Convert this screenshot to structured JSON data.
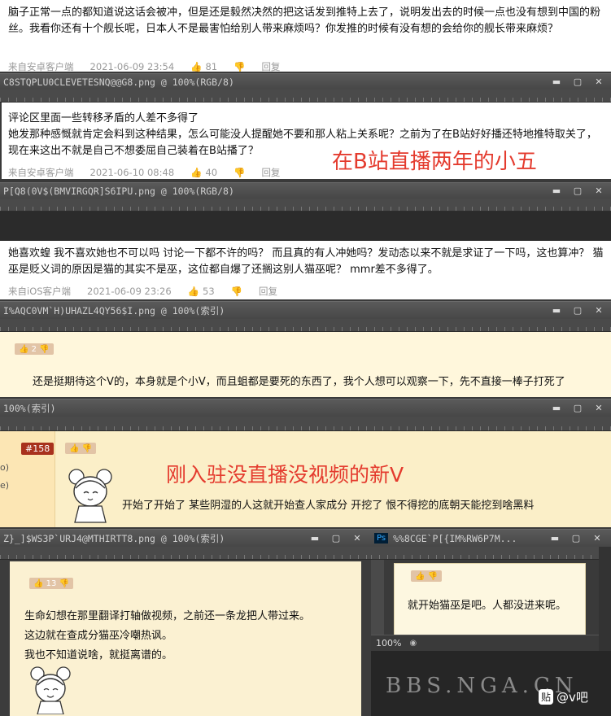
{
  "comments": [
    {
      "text": "脑子正常一点的都知道说这话会被冲，但是还是毅然决然的把这话发到推特上去了，说明发出去的时候一点也没有想到中国的粉丝。我看你还有十个舰长呢，日本人不是最害怕给别人带来麻烦吗？你发推的时候有没有想的会给你的舰长带来麻烦？",
      "source": "来自安卓客户端",
      "date": "2021-06-09 23:54",
      "likes": "81",
      "reply": "回复"
    },
    {
      "text": "评论区里面一些转移矛盾的人差不多得了\n她发那种感慨就肯定会料到这种结果，怎么可能没人提醒她不要和那人粘上关系呢？之前为了在B站好好播还特地推特取关了，现在来这出不就是自己不想委屈自己装着在B站播了？",
      "source": "来自安卓客户端",
      "date": "2021-06-10 08:48",
      "likes": "40",
      "reply": "回复",
      "overlay": "在B站直播两年的小五"
    },
    {
      "text": "她喜欢蝗 我不喜欢她也不可以吗 讨论一下都不许的吗？ 而且真的有人冲她吗？发动态以来不就是求证了一下吗，这也算冲？ 猫巫是贬义词的原因是猫的其实不是巫，这位都自爆了还搁这别人猫巫呢？ mmr差不多得了。",
      "source": "来自iOS客户端",
      "date": "2021-06-09 23:26",
      "likes": "53",
      "reply": "回复"
    }
  ],
  "ps_windows": [
    {
      "title": "C8STQPLU0CLEVETESNQ@@G8.png @ 100%(RGB/8)"
    },
    {
      "title": "P[Q8(0V$(BMVIRGQR]S6IPU.png @ 100%(RGB/8)"
    },
    {
      "title": "I%AQC0VM`H)UHAZL4QY56$I.png @ 100%(索引)"
    },
    {
      "title": "100%(索引)"
    },
    {
      "title": "Z}_]$WS3P`URJ4@MTHIRTT8.png @ 100%(索引)"
    },
    {
      "title": "%%8CGE`P[{IM%RW6P7M..."
    }
  ],
  "window_buttons": {
    "min": "▬",
    "max": "▢",
    "close": "✕"
  },
  "nga_posts": [
    {
      "likes": "2",
      "text": "还是挺期待这个V的，本身就是个小V，而且蛆都是要死的东西了，我个人想可以观察一下，先不直接一棒子打死了"
    },
    {
      "floor": "#158",
      "side_a": "o)",
      "side_b": "e)",
      "overlay": "刚入驻没直播没视频的新V",
      "text": "开始了开始了 某些阴湿的人这就开始查人家成分 开挖了 恨不得挖的底朝天能挖到啥黑料"
    },
    {
      "likes": "13",
      "lines": [
        "生命幻想在那里翻译打轴做视频，之前还一条龙把人带过来。",
        "这边就在查成分猫巫冷嘲热讽。",
        "我也不知道说啥，就挺离谱的。"
      ]
    },
    {
      "text": "就开始猫巫是吧。人都没进来呢。"
    }
  ],
  "ps_badge": "Ps",
  "zoom": "100%",
  "watermark": "BBS.NGA.CN",
  "corner_logo": "@v吧",
  "corner_icon": "贴"
}
